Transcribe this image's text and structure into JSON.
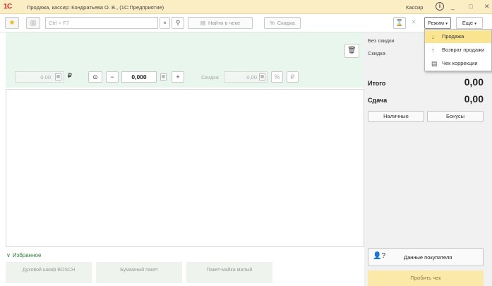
{
  "titlebar": {
    "logo": "1С",
    "title": "Продажа, кассир: Кондратьева О. В., (1С:Предприятие)",
    "user": "Кассир",
    "info_icon": "i",
    "minimize": "_",
    "maximize": "□",
    "close": "✕"
  },
  "toolbar": {
    "star_icon": "★",
    "barcode_icon": "▥",
    "search_placeholder": "Ctrl + F7",
    "clear": "×",
    "search_icon": "⚲",
    "find_check": "Найти в чеке",
    "find_check_icon": "▤",
    "discount": "Скидка",
    "discount_icon": "%",
    "hourglass_icon": "⌛",
    "close_icon": "✕",
    "modes": "Режим",
    "more": "Еще"
  },
  "modes_menu": {
    "items": [
      {
        "label": "Продажа",
        "icon": "↓",
        "icon_color": "#3a8a3a",
        "active": true
      },
      {
        "label": "Возврат продажи",
        "icon": "↑",
        "icon_color": "#d6232a",
        "active": false
      },
      {
        "label": "Чек коррекции",
        "icon": "▤",
        "icon_color": "#555555",
        "active": false
      }
    ]
  },
  "entry": {
    "trash_icon": "🗑",
    "price": "0.00",
    "calc_icon": "▦",
    "ruble": "₽",
    "eye_icon": "⊙",
    "minus": "−",
    "quantity": "0,000",
    "plus": "+",
    "discount_label": "Скидка",
    "discount_value": "0,00",
    "percent_icon": "%",
    "ruble_btn": "₽"
  },
  "favorites": {
    "header": "Избранное",
    "chevron": "∨",
    "tiles": [
      "Духовой шкаф BOSCH",
      "Бумажный пакет",
      "Пакет-майка малый"
    ]
  },
  "summary": {
    "no_discount_label": "Без скидки",
    "discount_label": "Скидка",
    "total_label": "Итого",
    "total_value": "0,00",
    "change_label": "Сдача",
    "change_value": "0,00",
    "cash_button": "Наличные",
    "bonus_button": "Бонусы",
    "customer_icon": "👤?",
    "customer_button": "Данные покупателя",
    "checkout_button": "Пробить чек"
  },
  "colors": {
    "titlebar_bg": "#fbeec4",
    "entry_bg": "#e9f6ee",
    "accent_yellow": "#fbe48f",
    "favorites_green": "#2f7d3a"
  }
}
